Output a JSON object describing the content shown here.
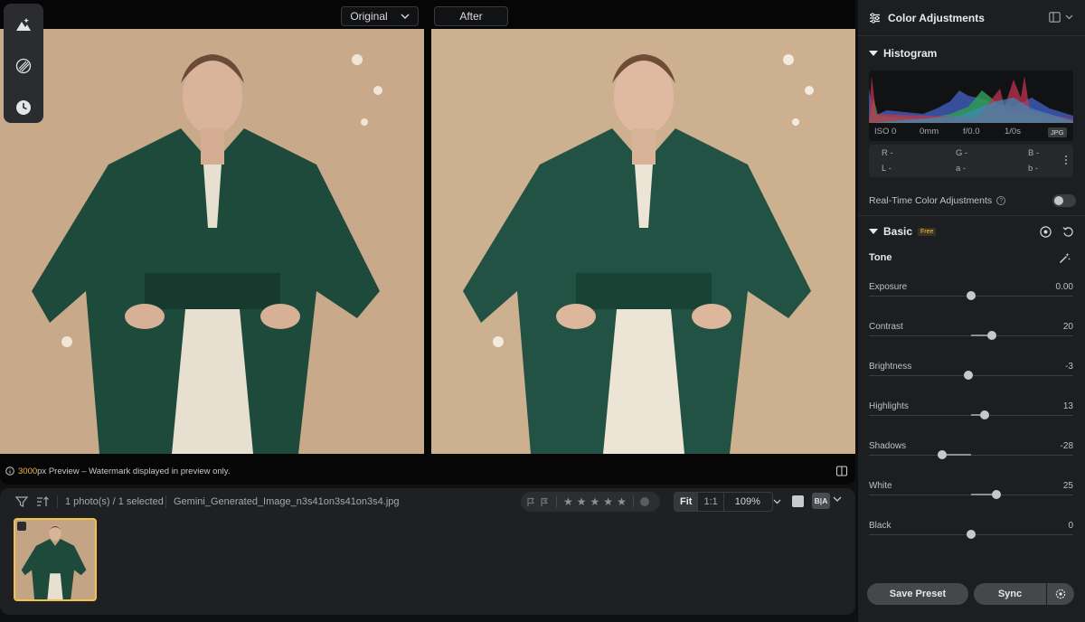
{
  "compare": {
    "original_label": "Original",
    "after_label": "After"
  },
  "tool_rail": {
    "items": [
      {
        "icon": "mountain-icon"
      },
      {
        "icon": "texture-icon"
      },
      {
        "icon": "history-clock-icon"
      }
    ]
  },
  "preview": {
    "px_value": "3000",
    "px_unit": "px",
    "text": " Preview – Watermark displayed in preview only."
  },
  "filmstrip": {
    "photo_count": "1 photo(s) / 1 selected",
    "file_name": "Gemini_Generated_Image_n3s41on3s41on3s4.jpg",
    "rating": 0,
    "zoom_fit": "Fit",
    "zoom_one": "1:1",
    "zoom_level": "109%",
    "view_ba": "B|A"
  },
  "panel": {
    "title": "Color Adjustments",
    "histogram": {
      "title": "Histogram",
      "iso": "ISO 0",
      "focal": "0mm",
      "aperture": "f/0.0",
      "shutter": "1/0s",
      "format": "JPG",
      "r": "R -",
      "g": "G -",
      "b": "B -",
      "l": "L -",
      "a": "a -",
      "b_lab": "b -"
    },
    "realtime": {
      "label": "Real-Time Color Adjustments",
      "enabled": false
    },
    "basic": {
      "title": "Basic",
      "badge": "Free",
      "tone_title": "Tone",
      "sliders": [
        {
          "label": "Exposure",
          "value": "0.00",
          "level": 0.5
        },
        {
          "label": "Contrast",
          "value": "20",
          "level": 0.6
        },
        {
          "label": "Brightness",
          "value": "-3",
          "level": 0.485
        },
        {
          "label": "Highlights",
          "value": "13",
          "level": 0.565
        },
        {
          "label": "Shadows",
          "value": "-28",
          "level": 0.36
        },
        {
          "label": "White",
          "value": "25",
          "level": 0.625
        },
        {
          "label": "Black",
          "value": "0",
          "level": 0.5
        }
      ]
    },
    "buttons": {
      "save_preset": "Save Preset",
      "sync": "Sync"
    }
  },
  "colors": {
    "accent": "#f0c24a",
    "coat": "#1f4a3c",
    "wall": "#c4a88a"
  }
}
